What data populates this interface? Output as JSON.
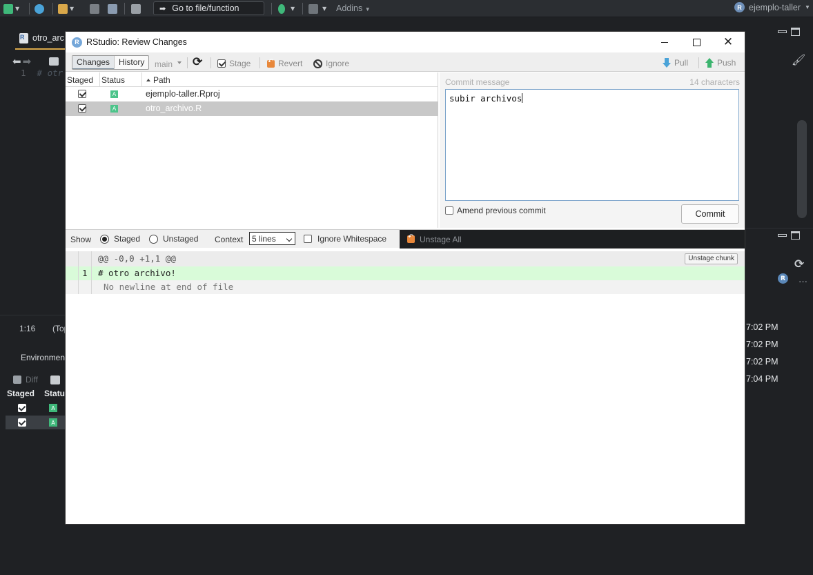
{
  "ide": {
    "toolbar": {
      "goto_label": "Go to file/function",
      "addins_label": "Addins"
    },
    "project_name": "ejemplo-taller",
    "source_tab": "otro_arc",
    "editor_line_number": "1",
    "editor_line_text": "# otr",
    "cursor_position": "1:16",
    "scope_label": "(Top",
    "env_tab": "Environmen",
    "git_pane": {
      "diff_label": "Diff",
      "headers": [
        "Staged",
        "Status"
      ],
      "rows": [
        {
          "status": "A"
        },
        {
          "status": "A"
        }
      ]
    },
    "history_times": [
      "7:02 PM",
      "7:02 PM",
      "7:02 PM",
      "7:04 PM"
    ]
  },
  "dialog": {
    "title": "RStudio: Review Changes",
    "window_buttons": {
      "close": "✕"
    },
    "toolbar": {
      "tabs": [
        "Changes",
        "History"
      ],
      "active_tab": "Changes",
      "branch": "main",
      "stage_label": "Stage",
      "revert_label": "Revert",
      "ignore_label": "Ignore",
      "pull_label": "Pull",
      "push_label": "Push"
    },
    "files": {
      "headers": {
        "staged": "Staged",
        "status": "Status",
        "path": "Path"
      },
      "rows": [
        {
          "staged": true,
          "status": "A",
          "path": "ejemplo-taller.Rproj",
          "selected": false
        },
        {
          "staged": true,
          "status": "A",
          "path": "otro_archivo.R",
          "selected": true
        }
      ]
    },
    "commit": {
      "label": "Commit message",
      "char_count": "14 characters",
      "message": "subir archivos",
      "amend_label": "Amend previous commit",
      "commit_button": "Commit"
    },
    "diff_toolbar": {
      "show_label": "Show",
      "staged_label": "Staged",
      "unstaged_label": "Unstaged",
      "context_label": "Context",
      "context_value": "5 lines",
      "ignore_ws_label": "Ignore Whitespace",
      "unstage_all_label": "Unstage All"
    },
    "diff": {
      "hunk_header": "@@ -0,0 +1,1 @@",
      "unstage_chunk_label": "Unstage chunk",
      "added_line_number": "1",
      "added_line_text": "# otro archivo!",
      "no_newline_text": "No newline at end of file"
    }
  }
}
